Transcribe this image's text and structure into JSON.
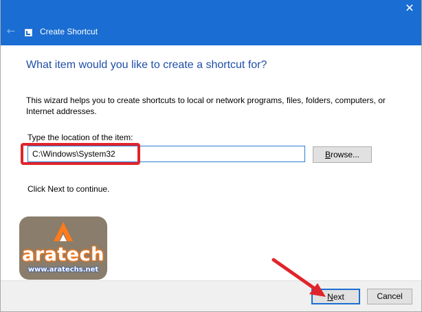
{
  "window": {
    "title": "Create Shortcut",
    "close_glyph": "✕",
    "back_glyph": "←",
    "titlebar_color": "#1a6dd2"
  },
  "wizard": {
    "heading": "What item would you like to create a shortcut for?",
    "description": "This wizard helps you to create shortcuts to local or network programs, files, folders, computers, or Internet addresses.",
    "location_label": "Type the location of the item:",
    "location_value": "C:\\Windows\\System32",
    "browse_label_underlined": "B",
    "browse_label_rest": "rowse...",
    "hint": "Click Next to continue."
  },
  "footer": {
    "next_label_underlined": "N",
    "next_label_rest": "ext",
    "cancel_label": "Cancel"
  },
  "watermark": {
    "brand": "aratech",
    "url": "www.aratechs.net"
  },
  "annotation": {
    "highlight_color": "#e0242c"
  },
  "icons": [
    "back-arrow-icon",
    "shortcut-icon",
    "close-icon",
    "aratech-logo"
  ]
}
